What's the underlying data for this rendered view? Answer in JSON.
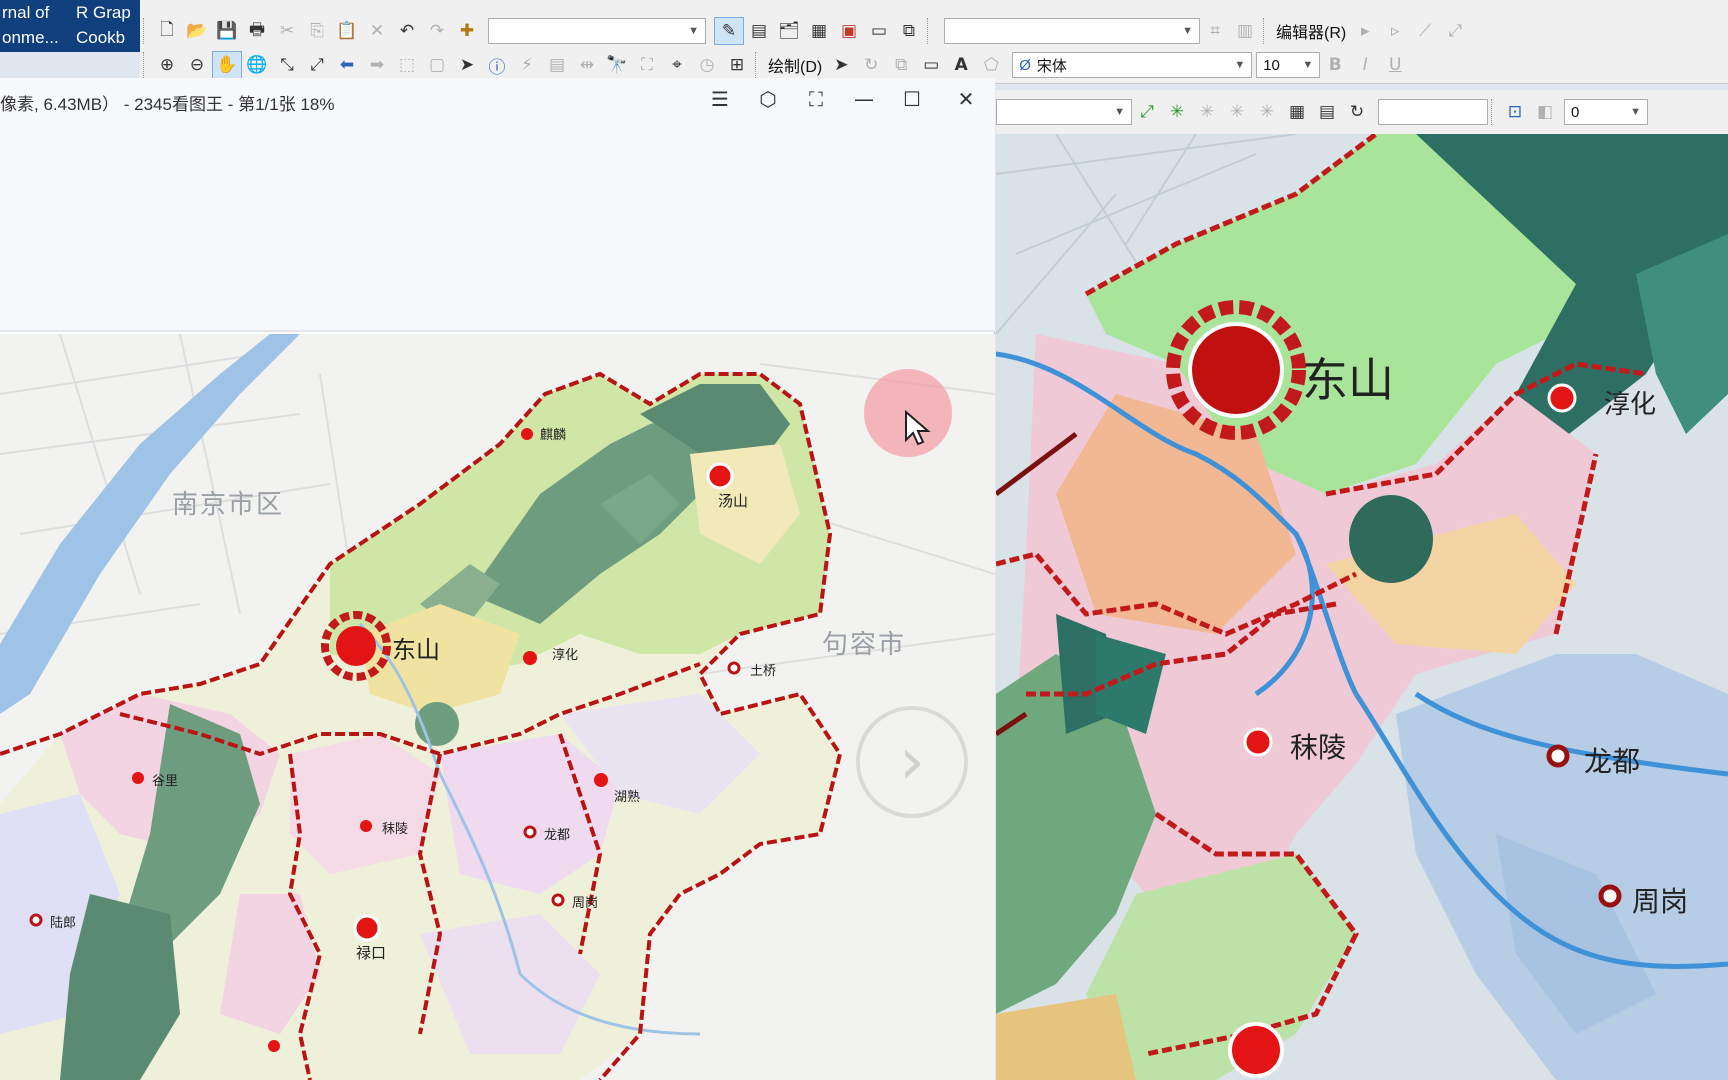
{
  "desktop": {
    "icon1_line1": "rnal of",
    "icon1_line2": "onme...",
    "icon2_line1": "R Grap",
    "icon2_line2": "Cookb"
  },
  "gis": {
    "editor_label": "编辑器(R)",
    "drawing_label": "绘制(D)",
    "font_name": "宋体",
    "font_size": "10",
    "bold": "B",
    "italic": "I",
    "underline": "U",
    "text_tool": "A",
    "value_combo": "0"
  },
  "viewer": {
    "title": "像素, 6.43MB） - 2345看图王 - 第1/1张 18%",
    "controls": {
      "menu": "☰",
      "skin": "⬡",
      "fullscreen": "⛶",
      "minimize": "—",
      "maximize": "☐",
      "close": "✕"
    },
    "next": "›"
  },
  "left_map": {
    "cities": [
      "南京市区",
      "句容市"
    ],
    "places": [
      "麒麟",
      "汤山",
      "东山",
      "淳化",
      "土桥",
      "谷里",
      "湖熟",
      "秣陵",
      "龙都",
      "周岗",
      "陆郎",
      "禄口"
    ]
  },
  "right_map": {
    "places": [
      "东山",
      "淳化",
      "秣陵",
      "龙都",
      "周岗"
    ]
  },
  "colors": {
    "boundary": "#c21a1a",
    "center": "#e31414",
    "forest": "#5a8a72",
    "green": "#b8e0a0",
    "pink": "#f4d0e0",
    "water": "#9fc3e6"
  }
}
